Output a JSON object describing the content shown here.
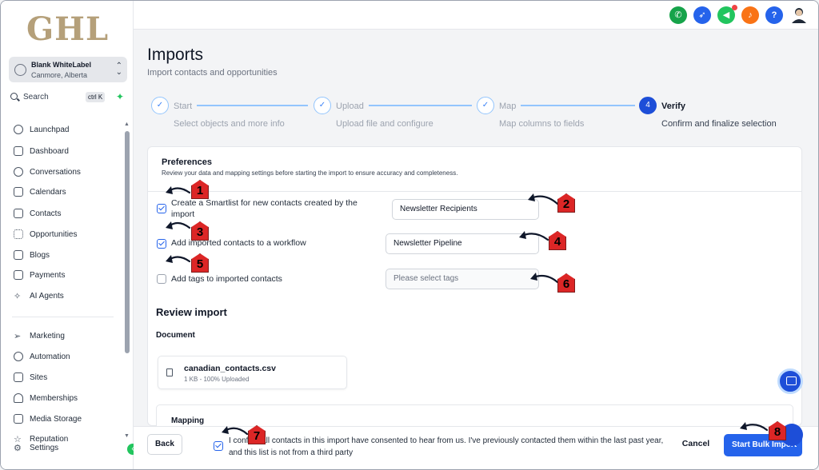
{
  "brand": {
    "logo_text": "GHL"
  },
  "account": {
    "name": "Blank WhiteLabel",
    "location": "Canmore, Alberta"
  },
  "search": {
    "label": "Search",
    "shortcut": "ctrl K"
  },
  "sidebar": {
    "items": [
      {
        "label": "Launchpad",
        "icon": "rocket-icon"
      },
      {
        "label": "Dashboard",
        "icon": "grid-icon"
      },
      {
        "label": "Conversations",
        "icon": "chat-icon"
      },
      {
        "label": "Calendars",
        "icon": "calendar-icon"
      },
      {
        "label": "Contacts",
        "icon": "contacts-icon"
      },
      {
        "label": "Opportunities",
        "icon": "funnel-icon"
      },
      {
        "label": "Blogs",
        "icon": "cube-icon"
      },
      {
        "label": "Payments",
        "icon": "receipt-icon"
      },
      {
        "label": "AI Agents",
        "icon": "sparkle-icon"
      },
      {
        "label": "Marketing",
        "icon": "send-icon"
      },
      {
        "label": "Automation",
        "icon": "automation-icon"
      },
      {
        "label": "Sites",
        "icon": "sites-icon"
      },
      {
        "label": "Memberships",
        "icon": "membership-icon"
      },
      {
        "label": "Media Storage",
        "icon": "image-icon"
      },
      {
        "label": "Reputation",
        "icon": "star-icon"
      },
      {
        "label": "Settings",
        "icon": "gear-icon"
      }
    ]
  },
  "topbar": {
    "colors": {
      "phone": "#16a34a",
      "rocket": "#2563eb",
      "megaphone": "#22c55e",
      "bell": "#f97316",
      "help": "#2563eb"
    }
  },
  "page": {
    "title": "Imports",
    "subtitle": "Import contacts and opportunities"
  },
  "steps": [
    {
      "number": "1",
      "title": "Start",
      "desc": "Select objects and more info",
      "state": "done"
    },
    {
      "number": "2",
      "title": "Upload",
      "desc": "Upload file and configure",
      "state": "done"
    },
    {
      "number": "3",
      "title": "Map",
      "desc": "Map columns to fields",
      "state": "done"
    },
    {
      "number": "4",
      "title": "Verify",
      "desc": "Confirm and finalize selection",
      "state": "active"
    }
  ],
  "preferences": {
    "title": "Preferences",
    "subtitle": "Review your data and mapping settings before starting the import to ensure accuracy and completeness.",
    "smartlist_label": "Create a Smartlist for new contacts created by the import",
    "smartlist_checked": true,
    "smartlist_value": "Newsletter Recipients",
    "workflow_label": "Add imported contacts to a workflow",
    "workflow_checked": true,
    "workflow_value": "Newsletter Pipeline",
    "tags_label": "Add tags to imported contacts",
    "tags_checked": false,
    "tags_placeholder": "Please select tags"
  },
  "review": {
    "title": "Review import",
    "document_label": "Document",
    "file_name": "canadian_contacts.csv",
    "file_meta": "1 KB - 100% Uploaded",
    "mapping_label": "Mapping"
  },
  "footer": {
    "back_label": "Back",
    "consent_text": "I confirm all contacts in this import have consented to hear from us. I've previously contacted them within the last past year, and this list is not from a third party",
    "consent_checked": true,
    "cancel_label": "Cancel",
    "start_label": "Start Bulk Import"
  },
  "annotations": [
    "1",
    "2",
    "3",
    "4",
    "5",
    "6",
    "7",
    "8"
  ]
}
